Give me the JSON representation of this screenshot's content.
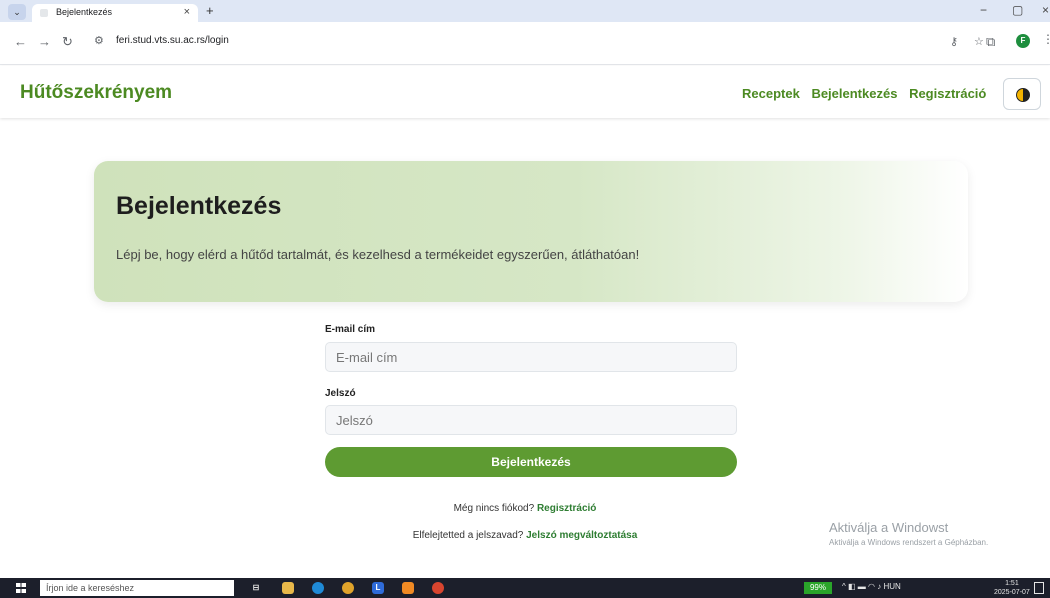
{
  "browser": {
    "tab_title": "Bejelentkezés",
    "tab_close": "×",
    "new_tab": "+",
    "url": "feri.stud.vts.su.ac.rs/login",
    "minimize": "−",
    "maximize": "▢",
    "close": "×",
    "profile_initial": "F"
  },
  "nav": {
    "brand": "Hűtőszekrényem",
    "links": [
      "Receptek",
      "Bejelentkezés",
      "Regisztráció"
    ]
  },
  "hero": {
    "title": "Bejelentkezés",
    "subtitle": "Lépj be, hogy elérd a hűtőd tartalmát, és kezelhesd a termékeidet egyszerűen, átláthatóan!"
  },
  "form": {
    "email_label": "E-mail cím",
    "email_placeholder": "E-mail cím",
    "password_label": "Jelszó",
    "password_placeholder": "Jelszó",
    "submit_label": "Bejelentkezés"
  },
  "links": {
    "no_account_text": "Még nincs fiókod?",
    "register_link": "Regisztráció",
    "forgot_text": "Elfelejtetted a jelszavad?",
    "reset_link": "Jelszó megváltoztatása"
  },
  "watermark": {
    "title": "Aktiválja a Windowst",
    "subtitle": "Aktiválja a Windows rendszert a Gépházban."
  },
  "taskbar": {
    "search_placeholder": "Írjon ide a kereséshez",
    "battery": "99%",
    "language": "HUN",
    "time": "1:51",
    "date": "2025-07-07"
  },
  "colors": {
    "brand_green": "#4c8a22",
    "button_green": "#5e9b32",
    "link_green": "#2e7d32"
  }
}
